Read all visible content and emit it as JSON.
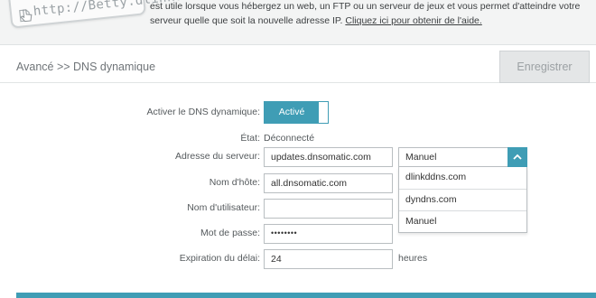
{
  "banner": {
    "url_graphic_text": "http://Betty.dlink.c",
    "text_before_link": "est utile lorsque vous hébergez un web, un FTP ou un serveur de jeux et vous permet d'atteindre votre serveur quelle que soit la nouvelle adresse IP. ",
    "link": "Cliquez ici pour obtenir de l'aide."
  },
  "header": {
    "breadcrumb": "Avancé >> DNS dynamique",
    "save_label": "Enregistrer"
  },
  "form": {
    "ddns_enable": {
      "label": "Activer le DNS dynamique:",
      "toggle_label": "Activé",
      "state": "on"
    },
    "status": {
      "label": "État:",
      "value": "Déconnecté"
    },
    "server_address": {
      "label": "Adresse du serveur:",
      "value": "updates.dnsomatic.com",
      "select_value": "Manuel",
      "options": [
        "dlinkddns.com",
        "dyndns.com",
        "Manuel"
      ]
    },
    "hostname": {
      "label": "Nom d'hôte:",
      "value": "all.dnsomatic.com"
    },
    "username": {
      "label": "Nom d'utilisateur:",
      "value": ""
    },
    "password": {
      "label": "Mot de passe:",
      "value": "••••••••"
    },
    "timeout": {
      "label": "Expiration du délai:",
      "value": "24",
      "unit": "heures"
    }
  },
  "colors": {
    "accent": "#3f9db5",
    "save_button_bg": "#e4e6e7",
    "banner_bg": "#f3f4f4"
  },
  "icons": {
    "cursor": "hand-pointer-icon",
    "dropdown_arrow": "chevron-up-icon",
    "url_graphic": "browser-address-bar-icon"
  }
}
